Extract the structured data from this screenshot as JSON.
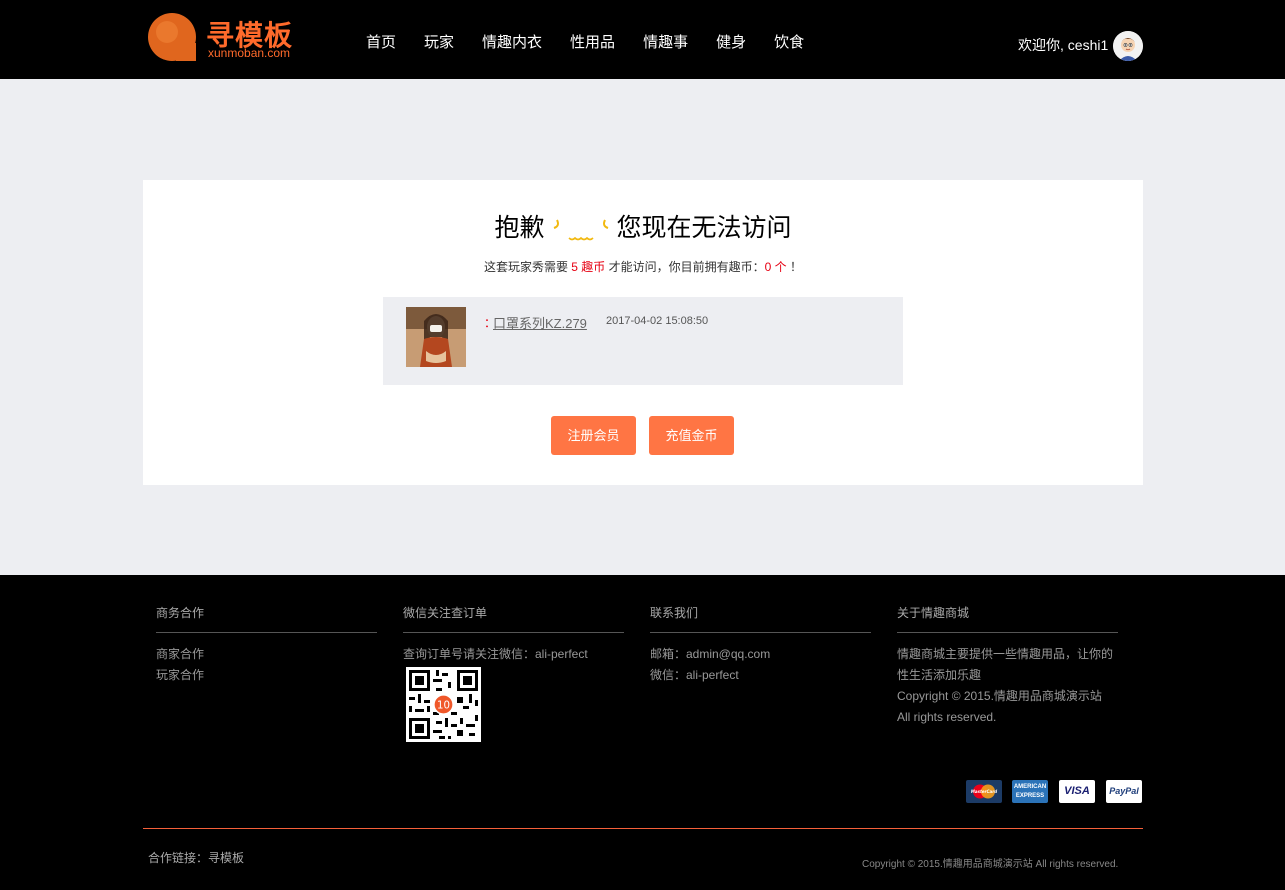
{
  "header": {
    "logo_name": "寻模板",
    "logo_sub": "xunmoban.com",
    "nav": [
      "首页",
      "玩家",
      "情趣内衣",
      "性用品",
      "情趣事",
      "健身",
      "饮食"
    ],
    "welcome": "欢迎你, ceshi1"
  },
  "notice": {
    "title_left": "抱歉",
    "title_right": "您现在无法访问",
    "sub_prefix": "这套玩家秀需要",
    "sub_cost": "5 趣币",
    "sub_mid": "才能访问，你目前拥有趣币：",
    "sub_have": "0 个",
    "sub_end": "！"
  },
  "item": {
    "colon": "：",
    "title": "口罩系列KZ.279",
    "time": "2017-04-02 15:08:50"
  },
  "buttons": {
    "register": "注册会员",
    "recharge": "充值金币"
  },
  "footer": {
    "cols": [
      {
        "title": "商务合作",
        "lines": [
          "商家合作",
          "玩家合作"
        ]
      },
      {
        "title": "微信关注查订单",
        "lines": [
          "查询订单号请关注微信：ali-perfect"
        ]
      },
      {
        "title": "联系我们",
        "lines": [
          "邮箱：admin@qq.com",
          "微信：ali-perfect"
        ]
      },
      {
        "title": "关于情趣商城",
        "lines": [
          "情趣商城主要提供一些情趣用品，让你的",
          "性生活添加乐趣",
          "Copyright © 2015.情趣用品商城演示站",
          "All rights reserved."
        ]
      }
    ],
    "qr_badge": "10",
    "payments": {
      "mastercard": "MasterCard",
      "amex_1": "AMERICAN",
      "amex_2": "EXPRESS",
      "visa": "VISA",
      "paypal": "PayPal"
    },
    "friend_link": "合作链接：寻模板",
    "copyright": "Copyright © 2015.情趣用品商城演示站 All rights reserved."
  },
  "colors": {
    "accent": "#ff7544",
    "brand": "#ff6a2b",
    "red": "#e60012"
  }
}
